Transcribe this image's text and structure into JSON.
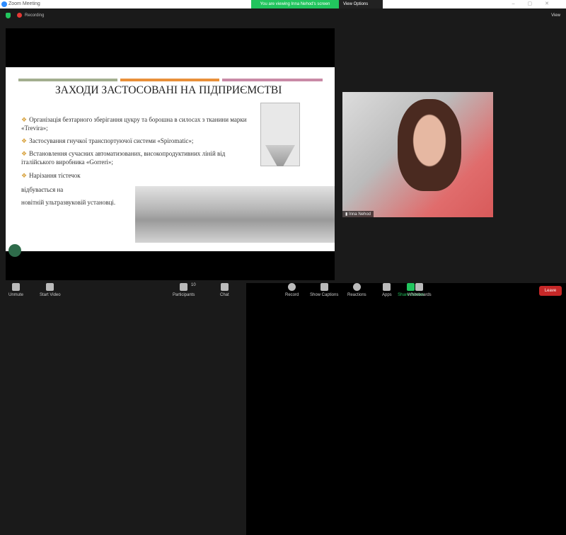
{
  "window": {
    "title": "Zoom Meeting"
  },
  "banner": {
    "viewing": "You are viewing Inna Nehod's screen",
    "view_options": "View Options"
  },
  "topbar": {
    "recording": "Recording",
    "view": "View"
  },
  "slide": {
    "title": "ЗАХОДИ ЗАСТОСОВАНІ НА ПІДПРИЄМСТВІ",
    "bullets": [
      "Організація безтарного зберігання цукру та борошна в силосах з тканини марки «Trevira»;",
      "Застосування гнучкої транспортуючої системи «Spiromatic»;",
      "Встановлення сучасних автоматизованих, високопродуктивних ліній від італійського виробника «Gorreri»;",
      "Нарізання тістечок"
    ],
    "line2": "відбувається на",
    "line3": "новітній ультразвуковій установці.",
    "bar_colors": [
      "#a3ae8f",
      "#e8903a",
      "#c98aa6"
    ]
  },
  "participant": {
    "name": "Inna Nehod"
  },
  "toolbar": {
    "unmute": "Unmute",
    "start_video": "Start Video",
    "participants": "Participants",
    "participants_count": "10",
    "chat": "Chat",
    "share_screen": "Share Screen",
    "record": "Record",
    "captions": "Show Captions",
    "reactions": "Reactions",
    "apps": "Apps",
    "whiteboards": "Whiteboards",
    "leave": "Leave"
  }
}
